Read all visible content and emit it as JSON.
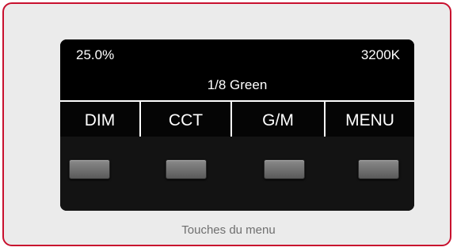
{
  "display": {
    "dim_value": "25.0%",
    "cct_value": "3200K",
    "gm_value": "1/8 Green"
  },
  "softkeys": [
    {
      "label": "DIM"
    },
    {
      "label": "CCT"
    },
    {
      "label": "G/M"
    },
    {
      "label": "MENU"
    }
  ],
  "caption": "Touches du menu",
  "colors": {
    "border_accent": "#c8102e",
    "panel_bg": "#ebebeb",
    "device_bg": "#111111",
    "button_gray": "#7a7a7a"
  }
}
